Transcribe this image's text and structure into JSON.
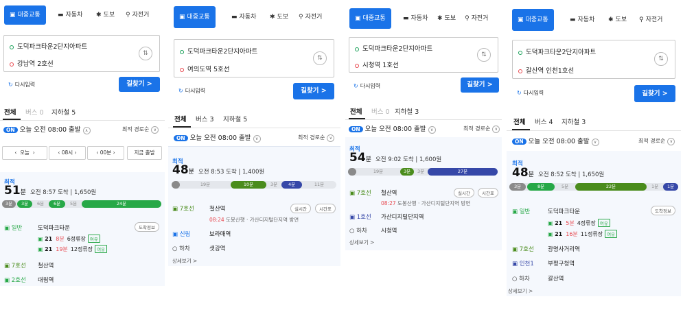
{
  "colors": {
    "accent": "#1a73e8",
    "line7": "#4a8c1c",
    "line1": "#3648a8",
    "bus": "#27a847",
    "red": "#e8484f"
  },
  "icons": {
    "transit": "bus-icon",
    "car": "car-icon",
    "walk": "walk-icon",
    "bike": "bike-icon"
  },
  "modes": {
    "transit": "대중교통",
    "car": "자동차",
    "walk": "도보",
    "bike": "자전거"
  },
  "common": {
    "origin": "도덕파크타운2단지아파트",
    "reset": "다시입력",
    "find": "길찾기 >",
    "tab_all": "전체",
    "on": "ON",
    "departure": "오늘 오전 08:00 출발",
    "sort": "최적 경로순",
    "best": "최적",
    "unit_min": "분",
    "more": "상세보기 >",
    "station_info": "도착정보",
    "realtime": "실시간",
    "timetable": "시간표",
    "getoff": "하차"
  },
  "panels": [
    {
      "dest": "강남역 2호선",
      "tab_bus": "버스 0",
      "tab_sub": "지하철 5",
      "nav": {
        "today": "오늘",
        "hour": "08시",
        "minute": "00분",
        "now": "지금 출발"
      },
      "dur": "51",
      "arrive": "오전 8:57 도착",
      "fare": "1,650원",
      "segs": [
        "3분",
        "3분",
        "6분",
        "6분",
        "5분",
        "24분"
      ],
      "rows": [
        {
          "line": "일반",
          "stop": "도덕파크타운",
          "buses": [
            {
              "no": "21",
              "min": "8분",
              "info": "6정류장",
              "tag": "여유"
            },
            {
              "no": "21",
              "min": "19분",
              "info": "12정류장",
              "tag": "여유"
            }
          ]
        },
        {
          "line": "7호선",
          "stop": "철산역"
        },
        {
          "line": "2호선",
          "stop": "대림역"
        }
      ]
    },
    {
      "dest": "여의도역 5호선",
      "tab_bus": "버스 3",
      "tab_sub": "지하철 5",
      "dur": "48",
      "arrive": "오전 8:53 도착",
      "fare": "1,400원",
      "segs": [
        "",
        "19분",
        "10분",
        "3분",
        "4분",
        "11분"
      ],
      "rows": [
        {
          "line": "7호선",
          "stop": "철산역",
          "time": "08:24",
          "sub": "도봉산행 · 가산디지털단지역 방면"
        },
        {
          "line": "신림",
          "stop": "보라매역"
        },
        {
          "line": "하차",
          "stop": "샛강역"
        }
      ]
    },
    {
      "dest": "시청역 1호선",
      "tab_bus": "버스 0",
      "tab_sub": "지하철 3",
      "dur": "54",
      "arrive": "오전 9:02 도착",
      "fare": "1,600원",
      "segs": [
        "",
        "19분",
        "3분",
        "3분",
        "27분"
      ],
      "rows": [
        {
          "line": "7호선",
          "stop": "철산역",
          "time": "08:27",
          "sub": "도봉산행 · 가산디지털단지역 방면"
        },
        {
          "line": "1호선",
          "stop": "가산디지털단지역"
        },
        {
          "line": "하차",
          "stop": "시청역"
        }
      ]
    },
    {
      "dest": "갈산역 인천1호선",
      "tab_bus": "버스 4",
      "tab_sub": "지하철 3",
      "dur": "48",
      "arrive": "오전 8:52 도착",
      "fare": "1,650원",
      "segs": [
        "3분",
        "8분",
        "5분",
        "22분",
        "1분",
        "1분"
      ],
      "rows": [
        {
          "line": "일반",
          "stop": "도덕파크타운",
          "buses": [
            {
              "no": "21",
              "min": "5분",
              "info": "4정류장",
              "tag": "여유"
            },
            {
              "no": "21",
              "min": "16분",
              "info": "11정류장",
              "tag": "여유"
            }
          ]
        },
        {
          "line": "7호선",
          "stop": "광명사거리역"
        },
        {
          "line": "인천1",
          "stop": "부평구청역"
        },
        {
          "line": "하차",
          "stop": "갈산역"
        }
      ]
    }
  ]
}
